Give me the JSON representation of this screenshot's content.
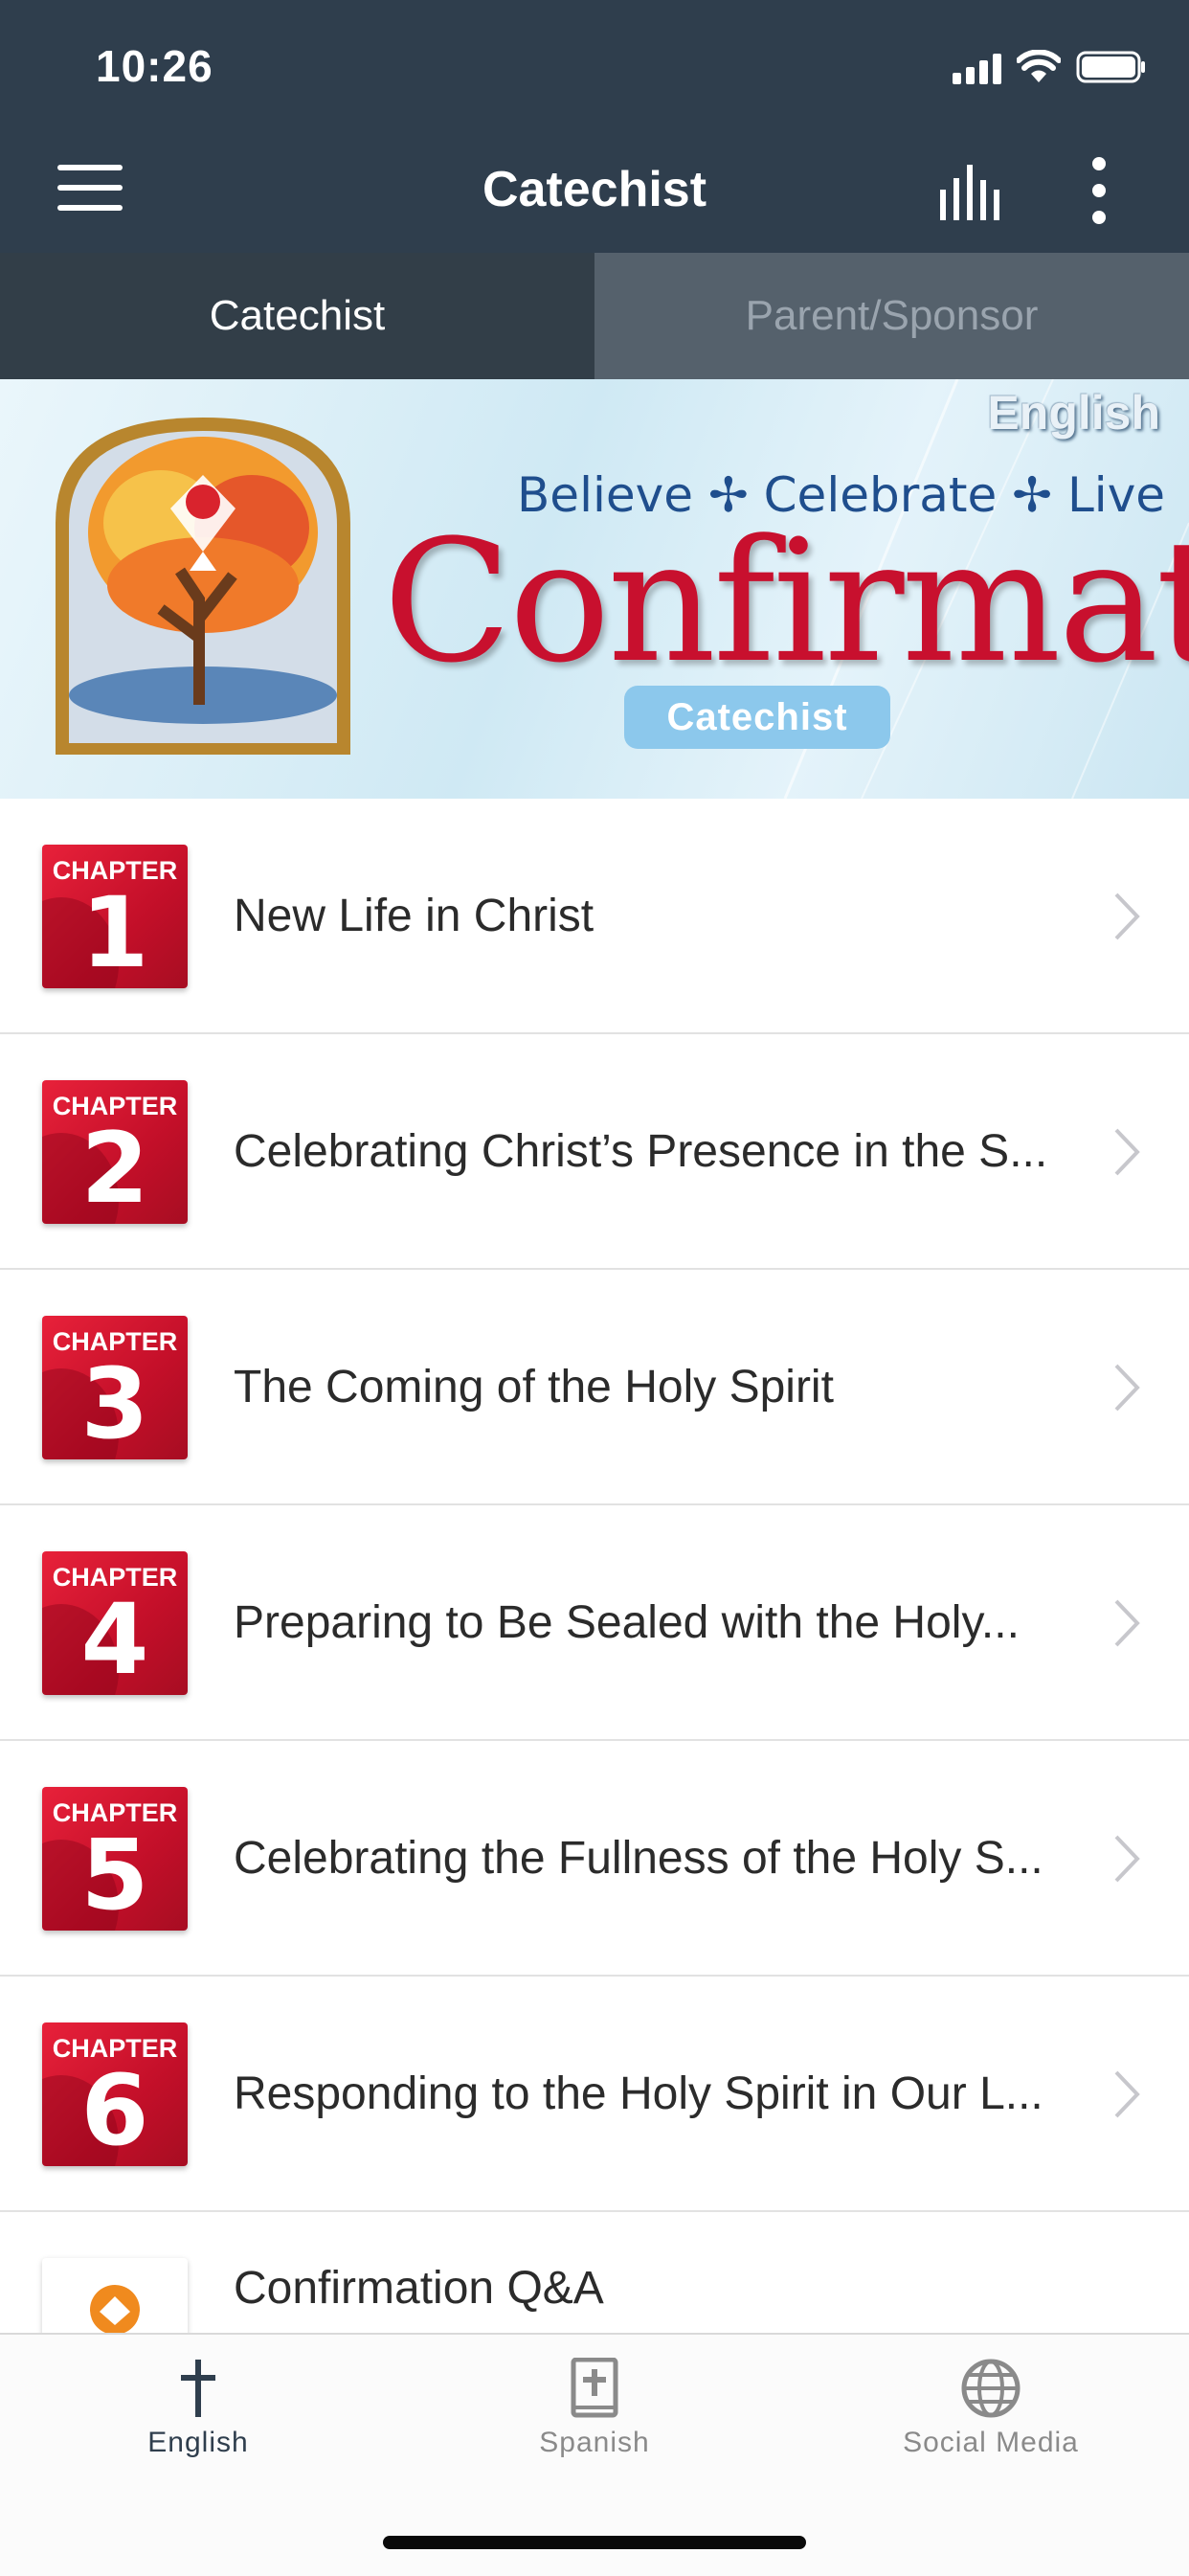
{
  "status_bar": {
    "time": "10:26"
  },
  "nav": {
    "title": "Catechist"
  },
  "tabs": [
    {
      "label": "Catechist",
      "active": true
    },
    {
      "label": "Parent/Sponsor",
      "active": false
    }
  ],
  "banner": {
    "language": "English",
    "tagline": "Believe ✢ Celebrate ✢ Live",
    "title": "Confirmation",
    "role": "Catechist"
  },
  "chapters": [
    {
      "word": "CHAPTER",
      "number": "1",
      "title": "New Life in Christ"
    },
    {
      "word": "CHAPTER",
      "number": "2",
      "title": "Celebrating Christ’s Presence in the S..."
    },
    {
      "word": "CHAPTER",
      "number": "3",
      "title": "The Coming of the Holy Spirit"
    },
    {
      "word": "CHAPTER",
      "number": "4",
      "title": "Preparing to Be Sealed with the Holy..."
    },
    {
      "word": "CHAPTER",
      "number": "5",
      "title": "Celebrating the Fullness of the Holy S..."
    },
    {
      "word": "CHAPTER",
      "number": "6",
      "title": "Responding to the Holy Spirit in Our L..."
    }
  ],
  "extra_item": {
    "title": "Confirmation Q&A"
  },
  "tabbar": [
    {
      "label": "English",
      "icon": "cross-icon",
      "active": true
    },
    {
      "label": "Spanish",
      "icon": "bible-icon",
      "active": false
    },
    {
      "label": "Social Media",
      "icon": "globe-icon",
      "active": false
    }
  ],
  "colors": {
    "header": "#2f3e4d",
    "chapter_badge": "#d7182f",
    "banner_title": "#c8102e",
    "banner_role": "#8cc8ec"
  }
}
